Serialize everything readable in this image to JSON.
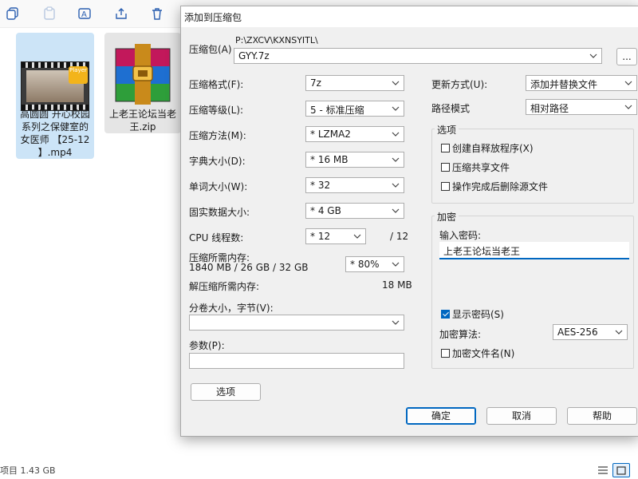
{
  "explorer": {
    "toolbar_icons": [
      "copy-icon",
      "paste-icon",
      "rename-icon",
      "share-icon",
      "delete-icon"
    ],
    "files": [
      {
        "name": "高圆圆 开心校园系列之保健室的女医师 【25-12】.mp4",
        "lines": [
          "高圆圆 开心校园",
          "系列之保健室的",
          "女医师 【25-12",
          "】.mp4"
        ],
        "badge": "Player"
      },
      {
        "name": "上老王论坛当老王.zip",
        "lines": [
          "上老王论坛当老",
          "王.zip"
        ]
      }
    ],
    "status_text": "项目 1.43 GB"
  },
  "dialog": {
    "title": "添加到压缩包",
    "archive": {
      "label": "压缩包(A)",
      "path": "P:\\ZXCV\\KXNSYITL\\",
      "name": "GYY.7z",
      "browse_label": "..."
    },
    "left": {
      "format": {
        "label": "压缩格式(F):",
        "value": "7z"
      },
      "level": {
        "label": "压缩等级(L):",
        "value": "5 - 标准压缩"
      },
      "method": {
        "label": "压缩方法(M):",
        "value": "* LZMA2"
      },
      "dict": {
        "label": "字典大小(D):",
        "value": "* 16 MB"
      },
      "word": {
        "label": "单词大小(W):",
        "value": "* 32"
      },
      "solid": {
        "label": "固实数据大小:",
        "value": "* 4 GB"
      },
      "cpu": {
        "label": "CPU 线程数:",
        "value": "* 12",
        "max": "/ 12"
      },
      "mem_compress": {
        "label": "压缩所需内存:",
        "detail": "1840 MB / 26 GB / 32 GB",
        "value": "* 80%"
      },
      "mem_decompress": {
        "label": "解压缩所需内存:",
        "value": "18 MB"
      },
      "volume": {
        "label": "分卷大小，字节(V):",
        "value": ""
      },
      "params": {
        "label": "参数(P):",
        "value": ""
      },
      "options_button": "选项"
    },
    "right": {
      "update_mode": {
        "label": "更新方式(U):",
        "value": "添加并替换文件"
      },
      "path_mode": {
        "label": "路径模式",
        "value": "相对路径"
      },
      "options": {
        "title": "选项",
        "items": [
          {
            "label": "创建自释放程序(X)",
            "checked": false
          },
          {
            "label": "压缩共享文件",
            "checked": false
          },
          {
            "label": "操作完成后删除源文件",
            "checked": false
          }
        ]
      },
      "encryption": {
        "title": "加密",
        "password_label": "输入密码:",
        "password_value": "上老王论坛当老王",
        "show_password": {
          "label": "显示密码(S)",
          "checked": true
        },
        "method_label": "加密算法:",
        "method_value": "AES-256",
        "encrypt_names": {
          "label": "加密文件名(N)",
          "checked": false
        }
      }
    },
    "buttons": {
      "ok": "确定",
      "cancel": "取消",
      "help": "帮助"
    }
  },
  "colors": {
    "accent": "#0067c0",
    "selection": "#cce4f7",
    "dialog_bg": "#f0f0f0"
  }
}
